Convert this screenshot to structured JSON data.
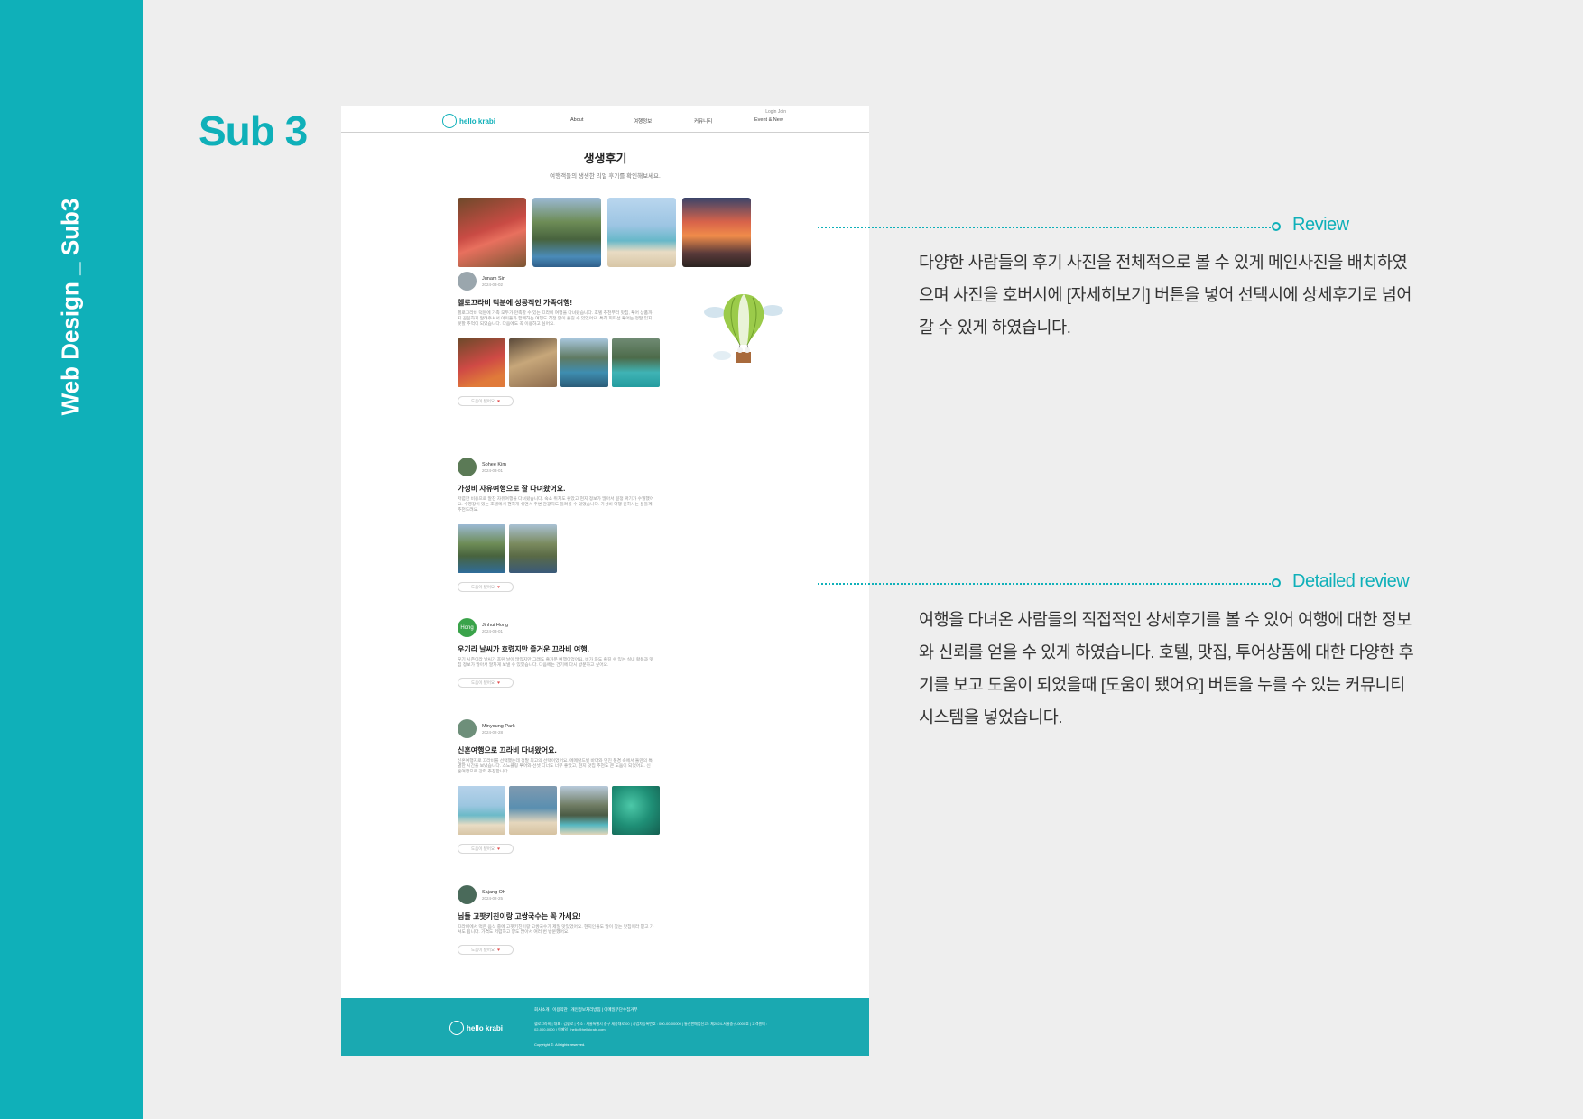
{
  "sidebar": {
    "title": "Web Design _ Sub3"
  },
  "section": {
    "title": "Sub 3"
  },
  "mock": {
    "header": {
      "logo_text": "hello krabi",
      "login_links": "Login  Join",
      "nav": [
        "About",
        "여행정보",
        "커뮤니티",
        "Event & New"
      ]
    },
    "page_title": "생생후기",
    "page_subtitle": "여행객들의 생생한 리얼 후기를 확인해보세요.",
    "help_label": "도움이 됐어요",
    "reviews": [
      {
        "name": "Junam Sin",
        "date": "2024-03-02",
        "title": "헬로끄라비 덕분에 성공적인 가족여행!",
        "body": "헬로끄라비 덕분에 가족 모두가 만족할 수 있는 끄라비 여행을 다녀왔습니다. 호텔 추천부터 맛집, 투어 상품까지 꼼꼼하게 알려주셔서 아이들과 함께하는 여행도 걱정 없이 즐길 수 있었어요. 특히 피피섬 투어는 정말 잊지 못할 추억이 되었습니다. 다음에도 꼭 이용하고 싶어요."
      },
      {
        "name": "Sohee Kim",
        "date": "2024-03-01",
        "title": "가성비 자유여행으로 잘 다녀왔어요.",
        "body": "저렴한 비용으로 알찬 자유여행을 다녀왔습니다. 숙소 위치도 좋았고 현지 정보가 많아서 일정 짜기가 수월했어요. 수영장이 있는 호텔에서 편하게 쉬면서 주변 관광지도 둘러볼 수 있었습니다. 가성비 여행 원하시는 분들께 추천드려요."
      },
      {
        "name": "Jinhui Hong",
        "avatar_text": "Hong",
        "date": "2024-03-01",
        "title": "우기라 날씨가 흐렸지만 즐거운 끄라비 여행.",
        "body": "우기 시즌이라 날씨가 흐린 날이 많았지만 그래도 즐거운 여행이었어요. 비가 와도 즐길 수 있는 실내 활동과 맛집 정보가 많아서 알차게 보낼 수 있었습니다. 다음에는 건기에 다시 방문하고 싶어요."
      },
      {
        "name": "Minyoung Park",
        "date": "2024-02-28",
        "title": "신혼여행으로 끄라비 다녀왔어요.",
        "body": "신혼여행지로 끄라비를 선택했는데 정말 최고의 선택이었어요. 에메랄드빛 바다와 멋진 풍경 속에서 둘만의 특별한 시간을 보냈습니다. 스노클링 투어와 선셋 디너도 너무 좋았고, 현지 맛집 추천도 큰 도움이 되었어요. 신혼여행으로 강력 추천합니다."
      },
      {
        "name": "Sajang Oh",
        "date": "2024-02-25",
        "title": "님들 고팟키친이랑 고쌍국수는 꼭 가세요!",
        "body": "끄라비에서 먹은 음식 중에 고팟키친이랑 고쌍국수가 제일 맛있었어요. 현지인들도 많이 찾는 맛집이라 믿고 가셔도 됩니다. 가격도 저렴하고 양도 많아서 여러 번 방문했어요."
      }
    ],
    "footer": {
      "logo_text": "hello krabi",
      "links": "회사소개  |  이용약관  |  개인정보처리방침  |  이메일무단수집거부",
      "info": "헬로끄라비  |  대표 : 김헬로  |  주소 : 서울특별시 중구 세종대로 00  |  사업자등록번호 : 000-00-00000  |  통신판매업신고 : 제2024-서울중구-0000호  |  고객센터 : 02-000-0000  |  이메일 : hello@hellokrabi.com",
      "copyright": "Copyright ©. All rights reserved."
    }
  },
  "annotations": [
    {
      "label": "Review",
      "description": "다양한 사람들의 후기 사진을 전체적으로 볼 수 있게 메인사진을 배치하였으며 사진을 호버시에 [자세히보기] 버튼을 넣어 선택시에 상세후기로 넘어갈 수 있게 하였습니다."
    },
    {
      "label": "Detailed review",
      "description": "여행을 다녀온 사람들의 직접적인 상세후기를 볼 수 있어 여행에 대한 정보와 신뢰를 얻을 수 있게 하였습니다. 호텔, 맛집, 투어상품에 대한 다양한 후기를 보고 도움이 되었을때 [도움이 됐어요] 버튼을 누를 수 있는 커뮤니티 시스템을 넣었습니다."
    }
  ],
  "colors": {
    "accent": "#0fb0b9",
    "footer": "#1aa9b1",
    "background": "#eeeeee"
  }
}
